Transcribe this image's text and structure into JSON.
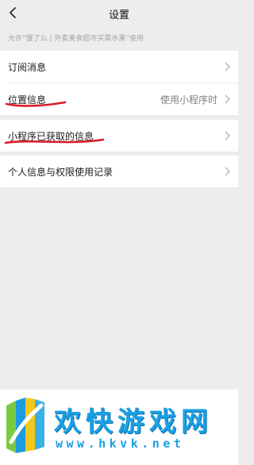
{
  "navbar": {
    "title": "设置"
  },
  "subtitle": "允许“饿了么 | 外卖美食超市买菜水果”使用",
  "groups": {
    "g1": [
      {
        "label": "订阅消息",
        "value": ""
      },
      {
        "label": "位置信息",
        "value": "使用小程序时"
      }
    ],
    "g2": [
      {
        "label": "小程序已获取的信息"
      }
    ],
    "g3": [
      {
        "label": "个人信息与权限使用记录"
      }
    ]
  },
  "watermark": {
    "brand": "欢快游戏网",
    "url": "www.hkvk.net"
  },
  "colors": {
    "annotation": "#d81b2a",
    "brand": "#1aa0e6"
  }
}
